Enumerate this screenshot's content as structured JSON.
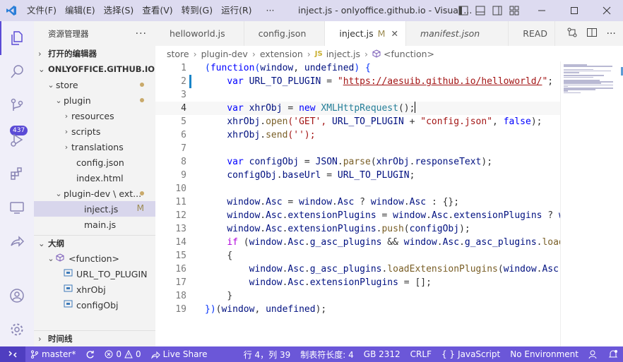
{
  "titlebar": {
    "menu": [
      "文件(F)",
      "编辑(E)",
      "选择(S)",
      "查看(V)",
      "转到(G)",
      "运行(R)",
      "···"
    ],
    "title": "inject.js - onlyoffice.github.io - Visual ..."
  },
  "activity": {
    "scm_badge": "437"
  },
  "sidebar": {
    "header": "资源管理器",
    "more": "···",
    "open_editors": "打开的编辑器",
    "workspace": "ONLYOFFICE.GITHUB.IO",
    "tree": [
      {
        "label": "store",
        "indent": 1,
        "chev": "⌄",
        "icon": "",
        "dot": true
      },
      {
        "label": "plugin",
        "indent": 2,
        "chev": "⌄",
        "icon": "",
        "dot": true
      },
      {
        "label": "resources",
        "indent": 3,
        "chev": "›",
        "icon": ""
      },
      {
        "label": "scripts",
        "indent": 3,
        "chev": "›",
        "icon": ""
      },
      {
        "label": "translations",
        "indent": 3,
        "chev": "›",
        "icon": ""
      },
      {
        "label": "config.json",
        "indent": 2,
        "chev": "",
        "icon": "{}"
      },
      {
        "label": "index.html",
        "indent": 2,
        "chev": "",
        "icon": "<>"
      },
      {
        "label": "plugin-dev \\ ext...",
        "indent": 2,
        "chev": "⌄",
        "icon": "",
        "dot": true
      },
      {
        "label": "inject.js",
        "indent": 3,
        "chev": "",
        "icon": "JS",
        "flag": "M",
        "selected": true
      },
      {
        "label": "main.js",
        "indent": 3,
        "chev": "",
        "icon": "JS"
      }
    ],
    "outline_title": "大纲",
    "outline": [
      {
        "label": "<function>",
        "indent": 1,
        "chev": "⌄",
        "icon": "cube"
      },
      {
        "label": "URL_TO_PLUGIN",
        "indent": 2,
        "chev": "",
        "icon": "var"
      },
      {
        "label": "xhrObj",
        "indent": 2,
        "chev": "",
        "icon": "var"
      },
      {
        "label": "configObj",
        "indent": 2,
        "chev": "",
        "icon": "var"
      }
    ],
    "timeline": "时间线"
  },
  "tabs": [
    {
      "label": "helloworld.js",
      "icon": "JS",
      "icon_color": "#c9b030",
      "italic": false
    },
    {
      "label": "config.json",
      "icon": "{}",
      "icon_color": "#c9b030",
      "italic": false
    },
    {
      "label": "inject.js",
      "icon": "JS",
      "icon_color": "#c9b030",
      "active": true,
      "flag": "M",
      "close": "✕"
    },
    {
      "label": "manifest.json",
      "icon": "{}",
      "icon_color": "#c9b030",
      "italic": true
    },
    {
      "label": "READ",
      "icon": "ⓘ",
      "icon_color": "#3d7ab8",
      "italic": false
    }
  ],
  "breadcrumb": [
    "store",
    "plugin-dev",
    "extension",
    "inject.js",
    "<function>"
  ],
  "code": [
    [
      [
        "(",
        "br1"
      ],
      [
        "function",
        "kw"
      ],
      [
        "(",
        "br1"
      ],
      [
        "window",
        "var"
      ],
      [
        ", ",
        "pun"
      ],
      [
        "undefined",
        "var"
      ],
      [
        ") {",
        "br1"
      ]
    ],
    [
      [
        "    "
      ],
      [
        "var ",
        "kw"
      ],
      [
        "URL_TO_PLUGIN",
        "var"
      ],
      [
        " = ",
        "pun"
      ],
      [
        "\"",
        "str"
      ],
      [
        "https://aesuib.github.io/helloworld/",
        "url"
      ],
      [
        "\"",
        "str"
      ],
      [
        ";",
        "pun"
      ]
    ],
    [],
    [
      [
        "    "
      ],
      [
        "var ",
        "kw"
      ],
      [
        "xhrObj",
        "var"
      ],
      [
        " = ",
        "pun"
      ],
      [
        "new ",
        "kw"
      ],
      [
        "XMLHttpRequest",
        "cls"
      ],
      [
        "();",
        "pun"
      ]
    ],
    [
      [
        "    "
      ],
      [
        "xhrObj",
        "var"
      ],
      [
        ".",
        "pun"
      ],
      [
        "open",
        "fn"
      ],
      [
        "('GET', ",
        "str"
      ],
      [
        "URL_TO_PLUGIN",
        "var"
      ],
      [
        " + ",
        "pun"
      ],
      [
        "\"config.json\"",
        "str"
      ],
      [
        ", ",
        "pun"
      ],
      [
        "false",
        "kw"
      ],
      [
        ");",
        "pun"
      ]
    ],
    [
      [
        "    "
      ],
      [
        "xhrObj",
        "var"
      ],
      [
        ".",
        "pun"
      ],
      [
        "send",
        "fn"
      ],
      [
        "('');",
        "str"
      ]
    ],
    [],
    [
      [
        "    "
      ],
      [
        "var ",
        "kw"
      ],
      [
        "configObj",
        "var"
      ],
      [
        " = ",
        "pun"
      ],
      [
        "JSON",
        "var"
      ],
      [
        ".",
        "pun"
      ],
      [
        "parse",
        "fn"
      ],
      [
        "(",
        "pun"
      ],
      [
        "xhrObj",
        "var"
      ],
      [
        ".",
        "pun"
      ],
      [
        "responseText",
        "var"
      ],
      [
        ");",
        "pun"
      ]
    ],
    [
      [
        "    "
      ],
      [
        "configObj",
        "var"
      ],
      [
        ".",
        "pun"
      ],
      [
        "baseUrl",
        "var"
      ],
      [
        " = ",
        "pun"
      ],
      [
        "URL_TO_PLUGIN",
        "var"
      ],
      [
        ";",
        "pun"
      ]
    ],
    [],
    [
      [
        "    "
      ],
      [
        "window",
        "var"
      ],
      [
        ".",
        "pun"
      ],
      [
        "Asc",
        "var"
      ],
      [
        " = ",
        "pun"
      ],
      [
        "window",
        "var"
      ],
      [
        ".",
        "pun"
      ],
      [
        "Asc",
        "var"
      ],
      [
        " ? ",
        "pun"
      ],
      [
        "window",
        "var"
      ],
      [
        ".",
        "pun"
      ],
      [
        "Asc",
        "var"
      ],
      [
        " : {};",
        "pun"
      ]
    ],
    [
      [
        "    "
      ],
      [
        "window",
        "var"
      ],
      [
        ".",
        "pun"
      ],
      [
        "Asc",
        "var"
      ],
      [
        ".",
        "pun"
      ],
      [
        "extensionPlugins",
        "var"
      ],
      [
        " = ",
        "pun"
      ],
      [
        "window",
        "var"
      ],
      [
        ".",
        "pun"
      ],
      [
        "Asc",
        "var"
      ],
      [
        ".",
        "pun"
      ],
      [
        "extensionPlugins",
        "var"
      ],
      [
        " ? ",
        "pun"
      ],
      [
        "wi",
        "var"
      ]
    ],
    [
      [
        "    "
      ],
      [
        "window",
        "var"
      ],
      [
        ".",
        "pun"
      ],
      [
        "Asc",
        "var"
      ],
      [
        ".",
        "pun"
      ],
      [
        "extensionPlugins",
        "var"
      ],
      [
        ".",
        "pun"
      ],
      [
        "push",
        "fn"
      ],
      [
        "(",
        "pun"
      ],
      [
        "configObj",
        "var"
      ],
      [
        ");",
        "pun"
      ]
    ],
    [
      [
        "    "
      ],
      [
        "if ",
        "ctl"
      ],
      [
        "(",
        "pun"
      ],
      [
        "window",
        "var"
      ],
      [
        ".",
        "pun"
      ],
      [
        "Asc",
        "var"
      ],
      [
        ".",
        "pun"
      ],
      [
        "g_asc_plugins",
        "var"
      ],
      [
        " && ",
        "pun"
      ],
      [
        "window",
        "var"
      ],
      [
        ".",
        "pun"
      ],
      [
        "Asc",
        "var"
      ],
      [
        ".",
        "pun"
      ],
      [
        "g_asc_plugins",
        "var"
      ],
      [
        ".",
        "pun"
      ],
      [
        "loadE",
        "fn"
      ]
    ],
    [
      [
        "    "
      ],
      [
        "{",
        "pun"
      ]
    ],
    [
      [
        "        "
      ],
      [
        "window",
        "var"
      ],
      [
        ".",
        "pun"
      ],
      [
        "Asc",
        "var"
      ],
      [
        ".",
        "pun"
      ],
      [
        "g_asc_plugins",
        "var"
      ],
      [
        ".",
        "pun"
      ],
      [
        "loadExtensionPlugins",
        "fn"
      ],
      [
        "(",
        "pun"
      ],
      [
        "window",
        "var"
      ],
      [
        ".",
        "pun"
      ],
      [
        "Asc",
        "var"
      ],
      [
        ".",
        "pun"
      ],
      [
        "e",
        "var"
      ]
    ],
    [
      [
        "        "
      ],
      [
        "window",
        "var"
      ],
      [
        ".",
        "pun"
      ],
      [
        "Asc",
        "var"
      ],
      [
        ".",
        "pun"
      ],
      [
        "extensionPlugins",
        "var"
      ],
      [
        " = [];",
        "pun"
      ]
    ],
    [
      [
        "    "
      ],
      [
        "}",
        "pun"
      ]
    ],
    [
      [
        "})",
        "br1"
      ],
      [
        "(",
        "pun"
      ],
      [
        "window",
        "var"
      ],
      [
        ", ",
        "pun"
      ],
      [
        "undefined",
        "var"
      ],
      [
        ");",
        "pun"
      ]
    ]
  ],
  "code_state": {
    "cursor_line": 4,
    "modified_line": 2
  },
  "status": {
    "branch": "master*",
    "errors": "0",
    "warnings": "0",
    "live_share": "Live Share",
    "position": "行 4，列 39",
    "indent": "制表符长度: 4",
    "encoding": "GB 2312",
    "eol": "CRLF",
    "language": "JavaScript",
    "env": "No Environment"
  }
}
